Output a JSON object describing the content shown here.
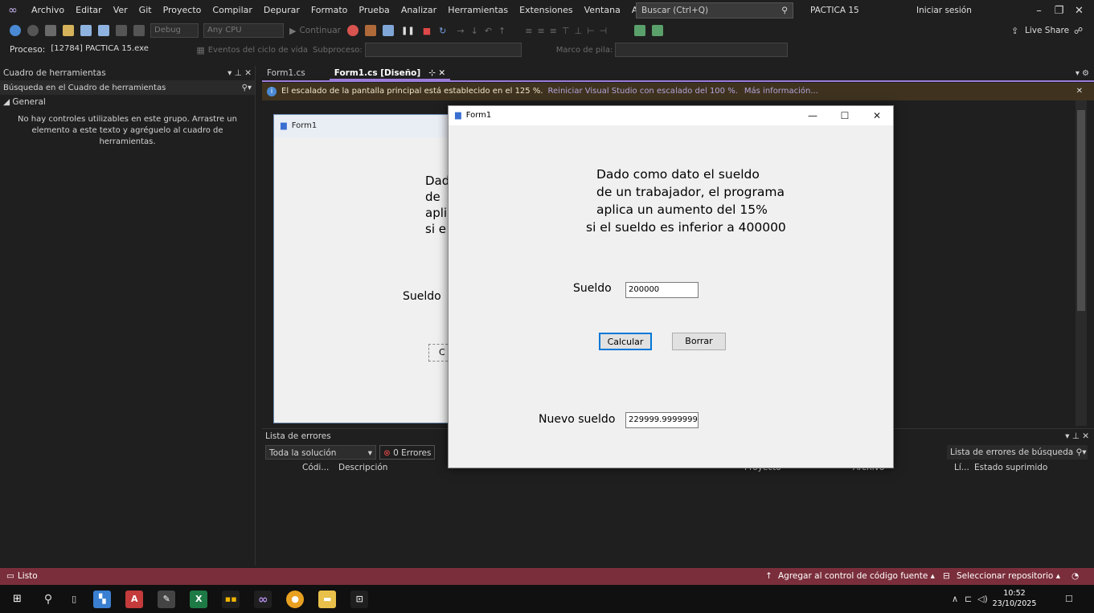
{
  "menu": [
    "Archivo",
    "Editar",
    "Ver",
    "Git",
    "Proyecto",
    "Compilar",
    "Depurar",
    "Formato",
    "Prueba",
    "Analizar",
    "Herramientas",
    "Extensiones",
    "Ventana",
    "Ayuda"
  ],
  "search_placeholder": "Buscar (Ctrl+Q)",
  "project_name": "PACTICA 15",
  "signin_label": "Iniciar sesión",
  "live_share_label": "Live Share",
  "toolbar": {
    "debug_combo": "Debug",
    "cpu_combo": "Any CPU",
    "continue_label": "Continuar",
    "process_label": "Proceso:",
    "process_value": "[12784] PACTICA 15.exe",
    "lifecycle_label": "Eventos del ciclo de vida",
    "thread_label": "Subproceso:",
    "stack_label": "Marco de pila:"
  },
  "toolbox": {
    "title": "Cuadro de herramientas",
    "search_placeholder": "Búsqueda en el Cuadro de herramientas",
    "group": "General",
    "empty_text": "No hay controles utilizables en este grupo. Arrastre un elemento a este texto y agréguelo al cuadro de herramientas."
  },
  "tabs": [
    {
      "label": "Form1.cs"
    },
    {
      "label": "Form1.cs [Diseño]"
    }
  ],
  "info_bar": {
    "message": "El escalado de la pantalla principal está establecido en el 125 %.",
    "restart_link": "Reiniciar Visual Studio con escalado del 100 %.",
    "more_info_link": "Más información..."
  },
  "designer": {
    "title": "Form1",
    "text_lines": [
      "Dad",
      "de",
      "apli",
      "si e"
    ],
    "sueldo_label": "Sueldo",
    "button_partial": "C"
  },
  "run_form": {
    "title": "Form1",
    "description_lines": [
      "Dado como dato el sueldo",
      "de un trabajador, el programa",
      "aplica un aumento del 15%",
      "si el sueldo es inferior a 400000"
    ],
    "sueldo_label": "Sueldo",
    "sueldo_value": "200000",
    "calcular_label": "Calcular",
    "borrar_label": "Borrar",
    "nuevo_label": "Nuevo sueldo",
    "nuevo_value": "229999.999999999"
  },
  "errorlist": {
    "title": "Lista de errores",
    "scope": "Toda la solución",
    "errors_badge": "0 Errores",
    "search_placeholder": "Lista de errores de búsqueda",
    "columns": [
      "Códi...",
      "Descripción",
      "Proyecto",
      "Archivo",
      "Lí...",
      "Estado suprimido"
    ]
  },
  "status": {
    "ready": "Listo",
    "add_source": "Agregar al control de código fuente",
    "select_repo": "Seleccionar repositorio"
  },
  "clock": {
    "time": "10:52",
    "date": "23/10/2025"
  },
  "colors": {
    "accent": "#9b7bd9",
    "status_bar": "#7a2e3b",
    "info_bar": "#3f3320"
  }
}
